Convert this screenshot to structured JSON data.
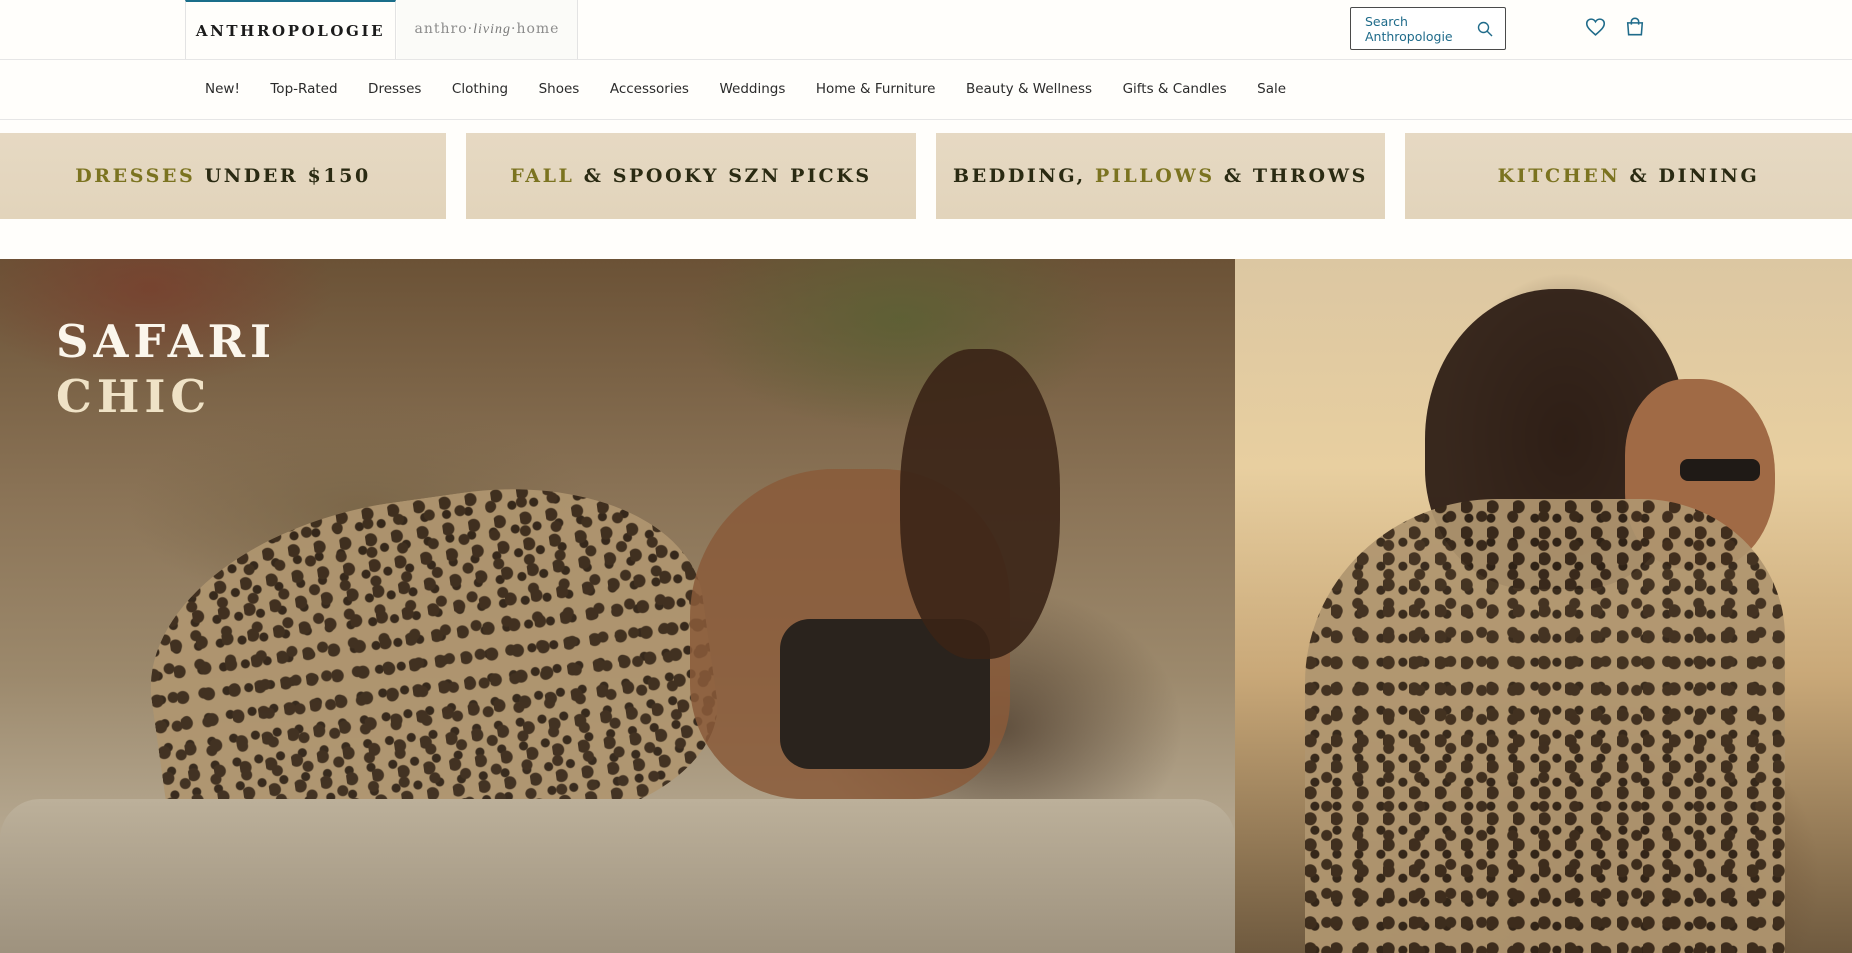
{
  "header": {
    "brand_primary": "ANTHROPOLOGIE",
    "brand_secondary_pre": "anthro",
    "brand_secondary_mid": "living",
    "brand_secondary_post": "home",
    "search_placeholder": "Search Anthropologie",
    "icons": [
      "search-icon",
      "heart-icon",
      "shopping-bag-icon"
    ],
    "accent_color": "#1a6e8a"
  },
  "nav": {
    "items": [
      "New!",
      "Top-Rated",
      "Dresses",
      "Clothing",
      "Shoes",
      "Accessories",
      "Weddings",
      "Home & Furniture",
      "Beauty & Wellness",
      "Gifts & Candles",
      "Sale"
    ]
  },
  "promos": [
    {
      "highlight": "DRESSES",
      "rest": " UNDER $150"
    },
    {
      "highlight": "FALL",
      "rest": " & SPOOKY SZN PICKS"
    },
    {
      "pre": "BEDDING, ",
      "highlight": "PILLOWS",
      "rest": " & THROWS"
    },
    {
      "highlight": "KITCHEN",
      "rest": " & DINING"
    }
  ],
  "hero": {
    "title_line1": "SAFARI",
    "title_line2": "CHIC"
  }
}
